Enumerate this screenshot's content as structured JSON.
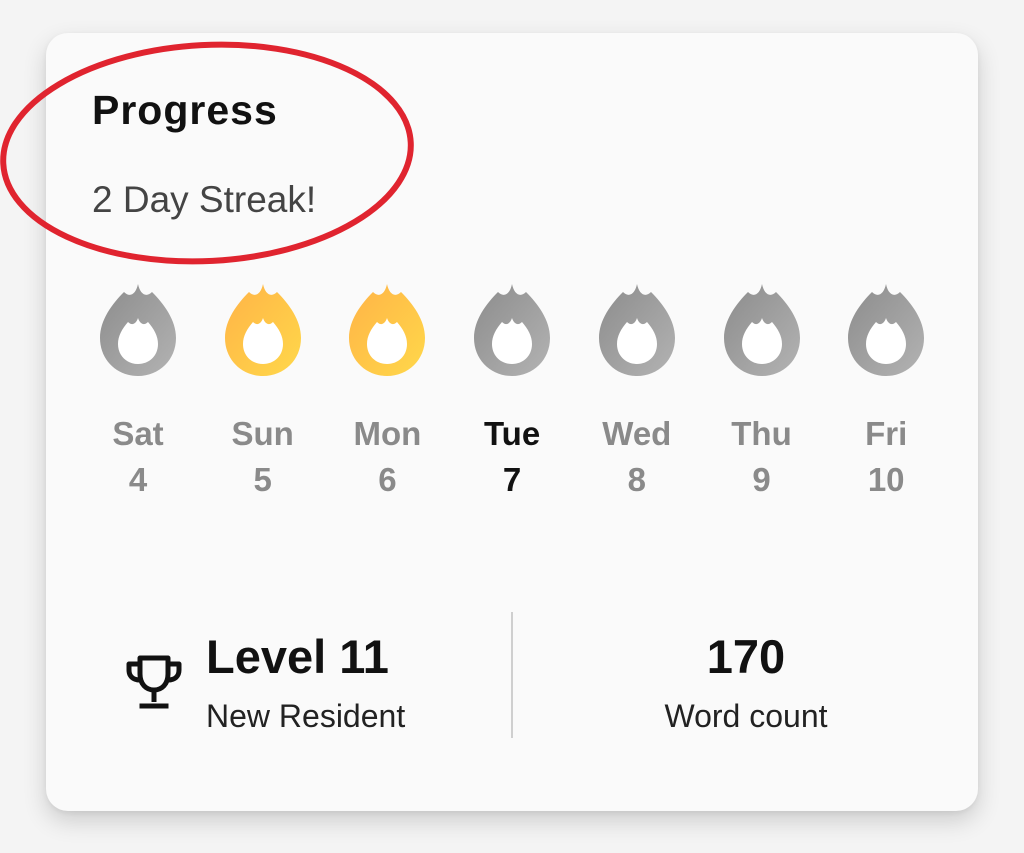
{
  "card": {
    "title": "Progress",
    "streak": "2 Day Streak!"
  },
  "days": [
    {
      "name": "Sat",
      "num": "4",
      "active": false,
      "today": false
    },
    {
      "name": "Sun",
      "num": "5",
      "active": true,
      "today": false
    },
    {
      "name": "Mon",
      "num": "6",
      "active": true,
      "today": false
    },
    {
      "name": "Tue",
      "num": "7",
      "active": false,
      "today": true
    },
    {
      "name": "Wed",
      "num": "8",
      "active": false,
      "today": false
    },
    {
      "name": "Thu",
      "num": "9",
      "active": false,
      "today": false
    },
    {
      "name": "Fri",
      "num": "10",
      "active": false,
      "today": false
    }
  ],
  "stats": {
    "level": "Level 11",
    "rank": "New Resident",
    "word_count": "170",
    "word_count_label": "Word count"
  },
  "icons": {
    "trophy": "trophy-icon",
    "flame": "flame-icon"
  },
  "colors": {
    "flame_active_top": "#ffb347",
    "flame_active_bottom": "#ffd84a",
    "flame_inactive_top": "#8c8c8c",
    "flame_inactive_bottom": "#b3b3b3",
    "annotation": "#e0242f"
  }
}
